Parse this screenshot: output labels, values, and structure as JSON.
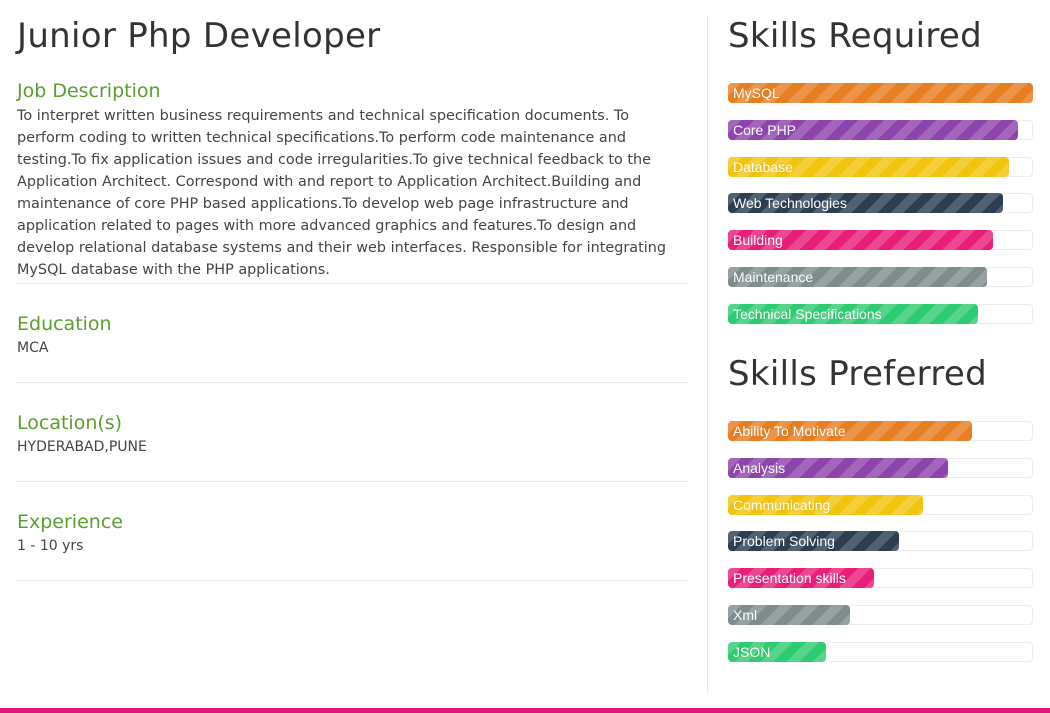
{
  "job": {
    "title": "Junior Php Developer",
    "description_heading": "Job Description",
    "description": "To interpret written business requirements and technical specification documents. To perform coding to written technical specifications.To perform code maintenance and testing.To fix application issues and code irregularities.To give technical feedback to the Application Architect. Correspond with and report to Application Architect.Building and maintenance of core PHP based applications.To develop web page infrastructure and application related to pages with more advanced graphics and features.To design and develop relational database systems and their web interfaces. Responsible for integrating MySQL database with the PHP applications.",
    "education_heading": "Education",
    "education": "MCA",
    "location_heading": "Location(s)",
    "location": "HYDERABAD,PUNE",
    "experience_heading": "Experience",
    "experience": "1 - 10 yrs"
  },
  "skills_required": {
    "title": "Skills Required",
    "items": [
      {
        "label": "MySQL",
        "level": 100,
        "color": "#e67e22"
      },
      {
        "label": "Core PHP",
        "level": 95,
        "color": "#8e44ad"
      },
      {
        "label": "Database",
        "level": 92,
        "color": "#f1c40f"
      },
      {
        "label": "Web Technologies",
        "level": 90,
        "color": "#2c3e50"
      },
      {
        "label": "Building",
        "level": 87,
        "color": "#e91e7a"
      },
      {
        "label": "Maintenance",
        "level": 85,
        "color": "#7f8c8d"
      },
      {
        "label": "Technical Specifications",
        "level": 82,
        "color": "#2ecc71"
      }
    ]
  },
  "skills_preferred": {
    "title": "Skills Preferred",
    "items": [
      {
        "label": "Ability To Motivate",
        "level": 80,
        "color": "#e67e22"
      },
      {
        "label": "Analysis",
        "level": 72,
        "color": "#8e44ad"
      },
      {
        "label": "Communicating",
        "level": 64,
        "color": "#f1c40f"
      },
      {
        "label": "Problem Solving",
        "level": 56,
        "color": "#2c3e50"
      },
      {
        "label": "Presentation skills",
        "level": 48,
        "color": "#e91e7a"
      },
      {
        "label": "Xml",
        "level": 40,
        "color": "#7f8c8d"
      },
      {
        "label": "JSON",
        "level": 32,
        "color": "#2ecc71"
      }
    ]
  },
  "theme": {
    "accent_bar_color": "#e0157a",
    "heading_green": "#5a9e2f"
  }
}
